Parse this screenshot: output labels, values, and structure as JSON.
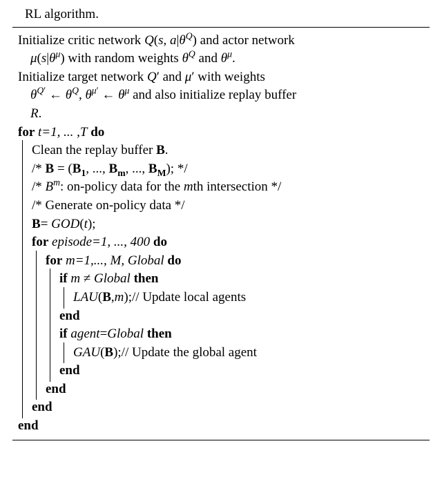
{
  "caption_tail": "RL algorithm.",
  "init_line1": "Initialize critic network Q(s, a|θ^Q) and actor network μ(s|θ^μ) with random weights θ^Q and θ^μ.",
  "init_line2": "Initialize target network Q′ and μ′ with weights θ^Q′ ← θ^Q, θ^μ′ ← θ^μ and also initialize replay buffer R.",
  "for_outer_head": "for t=1, ... ,T do",
  "clean_line": "Clean the replay buffer B.",
  "comment1": "/* B = (B₁, ..., B_m, ..., B_M); */",
  "comment2": "/* B^m: on-policy data for the mth intersection */",
  "comment3": "/* Generate on-policy data */",
  "god_line": "B= GOD(t);",
  "for_episode_head": "for episode=1, ..., 400 do",
  "for_m_head": "for m=1,..., M, Global do",
  "if_local_head": "if m ≠ Global then",
  "lau_line": "LAU(B,m);// Update local agents",
  "if_global_head": "if agent=Global then",
  "gau_line": "GAU(B);// Update the global agent",
  "end": "end"
}
